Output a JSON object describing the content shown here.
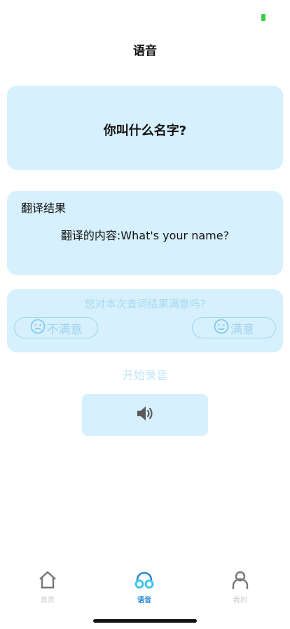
{
  "header": {
    "title": "语音"
  },
  "phrase_card": {
    "text": "你叫什么名字?"
  },
  "result_card": {
    "title": "翻译结果",
    "content": "翻译的内容:What's your name?"
  },
  "feedback": {
    "question": "您对本次查词结果满意吗?",
    "unsatisfied_label": "不满意",
    "satisfied_label": "满意"
  },
  "record": {
    "hint": "开始录音"
  },
  "tabbar": {
    "items": [
      {
        "label": "首页",
        "icon": "home-icon"
      },
      {
        "label": "语音",
        "icon": "headphones-icon",
        "active": true
      },
      {
        "label": "我的",
        "icon": "user-icon"
      }
    ]
  },
  "colors": {
    "card_bg": "#d6f1fd",
    "accent": "#2a8ad8",
    "muted": "#9fd0ec"
  }
}
